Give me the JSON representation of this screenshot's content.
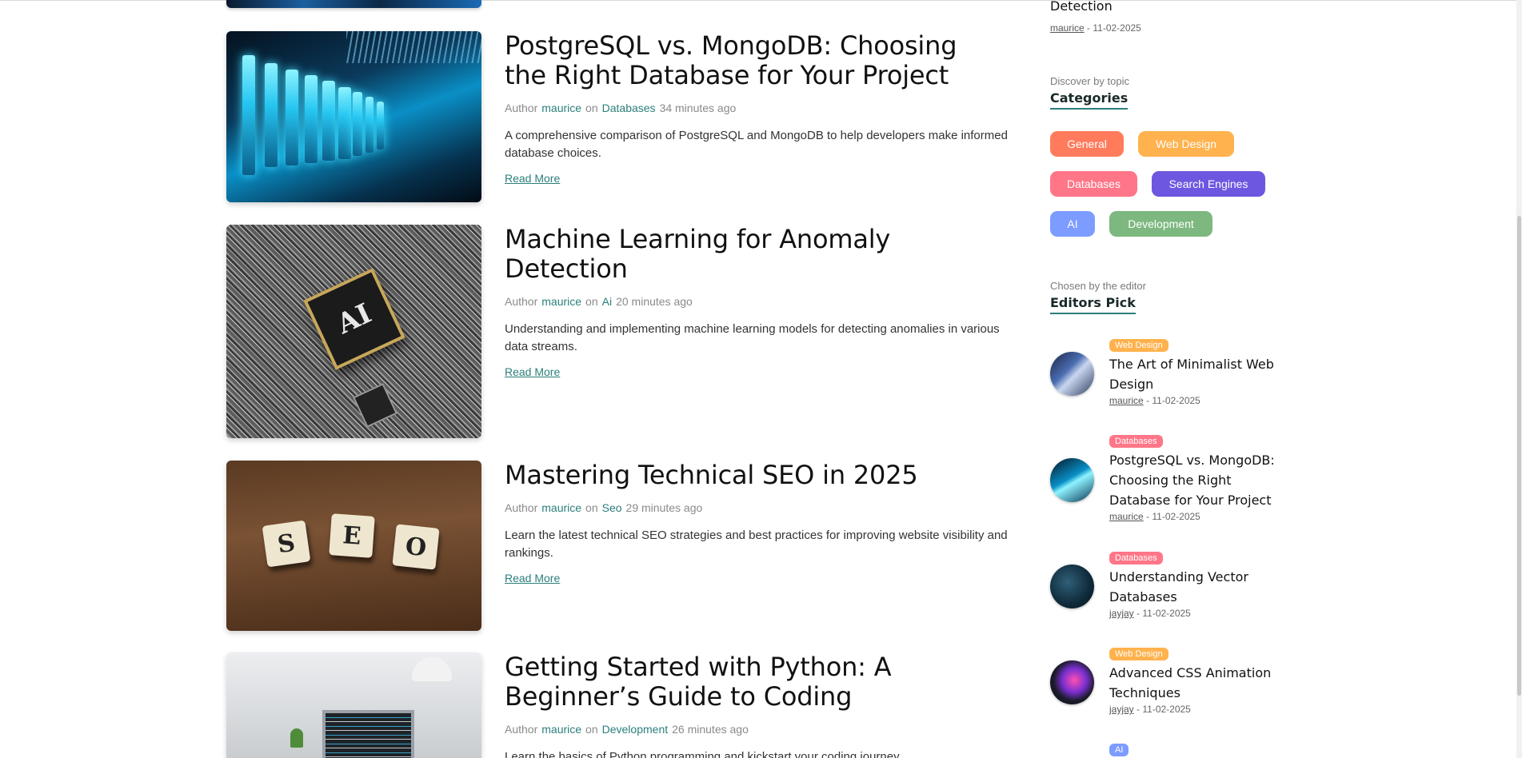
{
  "sidebar_previous": {
    "title": "Detection",
    "author": "maurice",
    "date": "11-02-2025"
  },
  "posts": [
    {
      "title_line1": "PostgreSQL vs. MongoDB: Choosing",
      "title_line2": "the Right Database for Your Project",
      "author_prefix": "Author",
      "author": "maurice",
      "on": "on",
      "category": "Databases",
      "time": "34 minutes ago",
      "excerpt": "A comprehensive comparison of PostgreSQL and MongoDB to help developers make informed database choices.",
      "read_more": "Read More"
    },
    {
      "title_line1": "Machine Learning for Anomaly",
      "title_line2": "Detection",
      "author_prefix": "Author",
      "author": "maurice",
      "on": "on",
      "category": "Ai",
      "time": "20 minutes ago",
      "excerpt": "Understanding and implementing machine learning models for detecting anomalies in various data streams.",
      "read_more": "Read More",
      "image_text": "AI"
    },
    {
      "title_line1": "Mastering Technical SEO in 2025",
      "title_line2": "",
      "author_prefix": "Author",
      "author": "maurice",
      "on": "on",
      "category": "Seo",
      "time": "29 minutes ago",
      "excerpt": "Learn the latest technical SEO strategies and best practices for improving website visibility and rankings.",
      "read_more": "Read More",
      "image_tiles": [
        "S",
        "E",
        "O"
      ]
    },
    {
      "title_line1": "Getting Started with Python: A",
      "title_line2": "Beginner’s Guide to Coding",
      "author_prefix": "Author",
      "author": "maurice",
      "on": "on",
      "category": "Development",
      "time": "26 minutes ago",
      "excerpt": "Learn the basics of Python programming and kickstart your coding journey."
    }
  ],
  "categories": {
    "kicker": "Discover by topic",
    "heading": "Categories",
    "items": [
      {
        "label": "General",
        "color": "#ff7b5c"
      },
      {
        "label": "Web Design",
        "color": "#ffb24d"
      },
      {
        "label": "Databases",
        "color": "#ff7688"
      },
      {
        "label": "Search Engines",
        "color": "#6e57e0"
      },
      {
        "label": "AI",
        "color": "#7c9cff"
      },
      {
        "label": "Development",
        "color": "#7cb87f"
      }
    ]
  },
  "editors_pick": {
    "kicker": "Chosen by the editor",
    "heading": "Editors Pick",
    "items": [
      {
        "badge": "Web Design",
        "badge_color": "#ffb24d",
        "title_line1": "The Art of Minimalist Web",
        "title_line2": "Design",
        "title_line3": "",
        "author": "maurice",
        "date": "11-02-2025"
      },
      {
        "badge": "Databases",
        "badge_color": "#ff7688",
        "title_line1": "PostgreSQL vs. MongoDB:",
        "title_line2": "Choosing the Right",
        "title_line3": "Database for Your Project",
        "author": "maurice",
        "date": "11-02-2025"
      },
      {
        "badge": "Databases",
        "badge_color": "#ff7688",
        "title_line1": "Understanding Vector",
        "title_line2": "Databases",
        "title_line3": "",
        "author": "jayjay",
        "date": "11-02-2025"
      },
      {
        "badge": "Web Design",
        "badge_color": "#ffb24d",
        "title_line1": "Advanced CSS Animation",
        "title_line2": "Techniques",
        "title_line3": "",
        "author": "jayjay",
        "date": "11-02-2025"
      },
      {
        "badge": "AI",
        "badge_color": "#7c9cff"
      }
    ]
  },
  "colors": {
    "accent": "#2a7f7a"
  }
}
